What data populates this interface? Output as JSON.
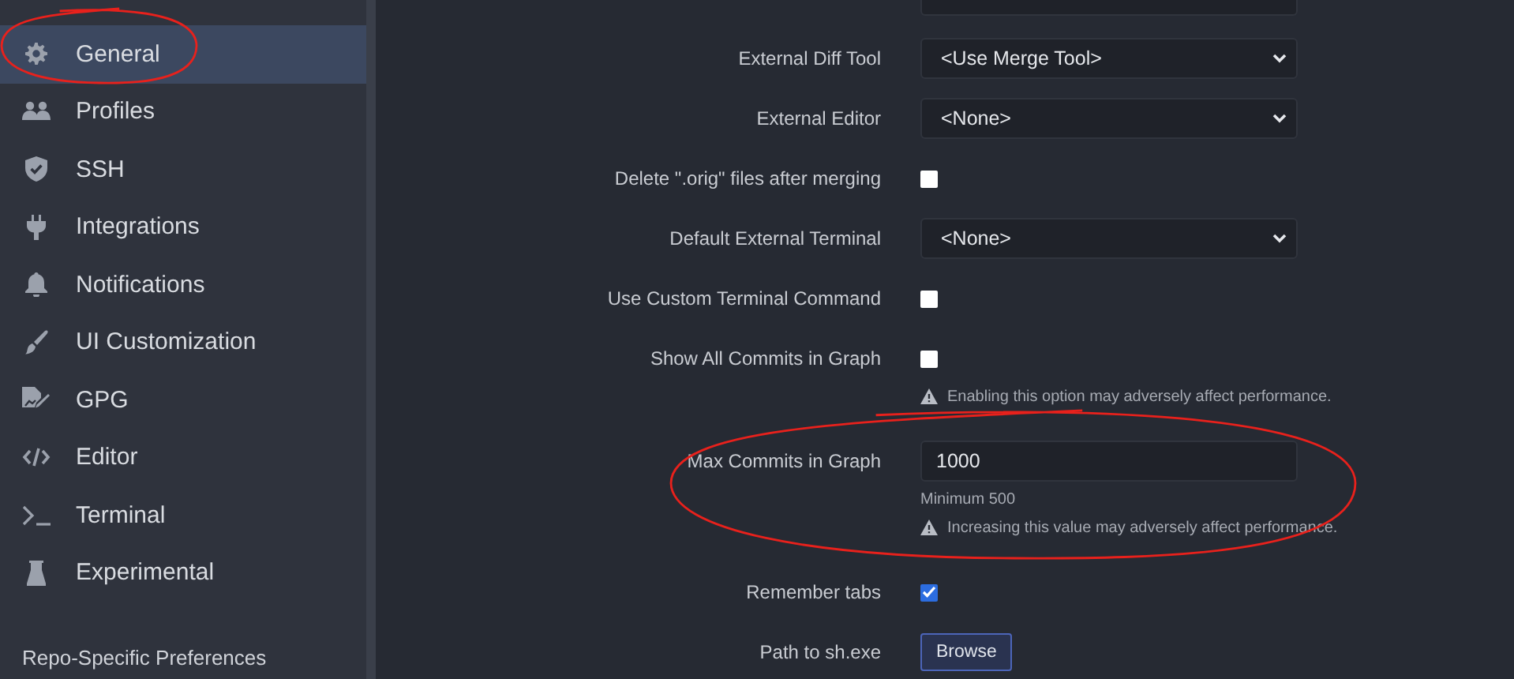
{
  "sidebar": {
    "items": [
      {
        "label": "General",
        "selected": true,
        "circled": true
      },
      {
        "label": "Profiles",
        "selected": false,
        "circled": false
      },
      {
        "label": "SSH",
        "selected": false,
        "circled": false
      },
      {
        "label": "Integrations",
        "selected": false,
        "circled": false
      },
      {
        "label": "Notifications",
        "selected": false,
        "circled": false
      },
      {
        "label": "UI Customization",
        "selected": false,
        "circled": false
      },
      {
        "label": "GPG",
        "selected": false,
        "circled": false
      },
      {
        "label": "Editor",
        "selected": false,
        "circled": false
      },
      {
        "label": "Terminal",
        "selected": false,
        "circled": false
      },
      {
        "label": "Experimental",
        "selected": false,
        "circled": false
      }
    ],
    "section_heading": "Repo-Specific Preferences"
  },
  "settings": [
    {
      "kind": "cut_select"
    },
    {
      "kind": "select",
      "label": "External Diff Tool",
      "value": "<Use Merge Tool>"
    },
    {
      "kind": "select",
      "label": "External Editor",
      "value": "<None>"
    },
    {
      "kind": "checkbox",
      "label": "Delete \".orig\" files after merging",
      "checked": false
    },
    {
      "kind": "select",
      "label": "Default External Terminal",
      "value": "<None>"
    },
    {
      "kind": "checkbox",
      "label": "Use Custom Terminal Command",
      "checked": false
    },
    {
      "kind": "checkbox",
      "label": "Show All Commits in Graph",
      "checked": false,
      "notes": [
        {
          "kind": "warning",
          "text": "Enabling this option may adversely affect performance."
        }
      ]
    },
    {
      "kind": "number",
      "label": "Max Commits in Graph",
      "value": "1000",
      "circled": true,
      "notes": [
        {
          "kind": "hint",
          "text": "Minimum 500"
        },
        {
          "kind": "warning",
          "text": "Increasing this value may adversely affect performance."
        }
      ]
    },
    {
      "kind": "checkbox",
      "label": "Remember tabs",
      "checked": true
    },
    {
      "kind": "button",
      "label": "Path to sh.exe",
      "button": "Browse"
    }
  ]
}
